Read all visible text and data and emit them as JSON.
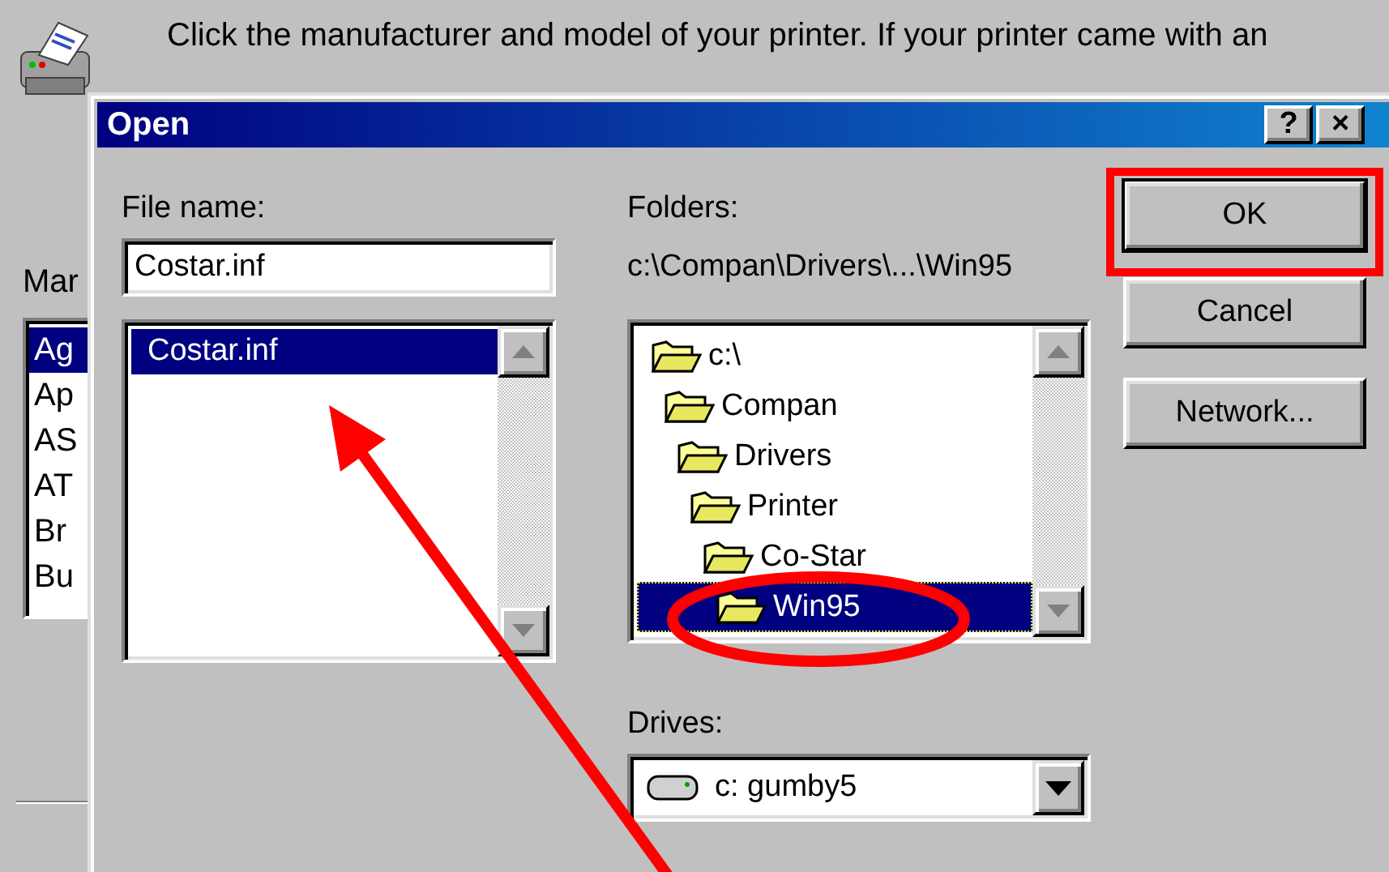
{
  "back_dialog": {
    "instructions": "Click the manufacturer and model of your printer. If your printer came with an",
    "manufacturers_label": "Mar",
    "manufacturers": [
      {
        "name": "Ag",
        "selected": true
      },
      {
        "name": "Ap",
        "selected": false
      },
      {
        "name": "AS",
        "selected": false
      },
      {
        "name": "AT",
        "selected": false
      },
      {
        "name": "Br",
        "selected": false
      },
      {
        "name": "Bu",
        "selected": false
      }
    ]
  },
  "dialog": {
    "title": "Open",
    "title_buttons": [
      "?",
      "×"
    ],
    "file_name": {
      "label": "File name:",
      "value": "Costar.inf"
    },
    "files": [
      {
        "name": "Costar.inf",
        "selected": true
      }
    ],
    "folders": {
      "label": "Folders:",
      "path": "c:\\Compan\\Drivers\\...\\Win95",
      "tree": [
        {
          "name": "c:\\",
          "selected": false,
          "children": [
            {
              "name": "Compan",
              "selected": false,
              "children": [
                {
                  "name": "Drivers",
                  "selected": false,
                  "children": [
                    {
                      "name": "Printer",
                      "selected": false,
                      "children": [
                        {
                          "name": "Co-Star",
                          "selected": false,
                          "children": [
                            {
                              "name": "Win95",
                              "selected": true
                            }
                          ]
                        }
                      ]
                    }
                  ]
                }
              ]
            }
          ]
        }
      ]
    },
    "drives": {
      "label": "Drives:",
      "value": "c: gumby5"
    },
    "buttons": [
      {
        "label": "OK",
        "default": true
      },
      {
        "label": "Cancel",
        "default": false
      },
      {
        "label": "Network...",
        "default": false
      }
    ]
  }
}
